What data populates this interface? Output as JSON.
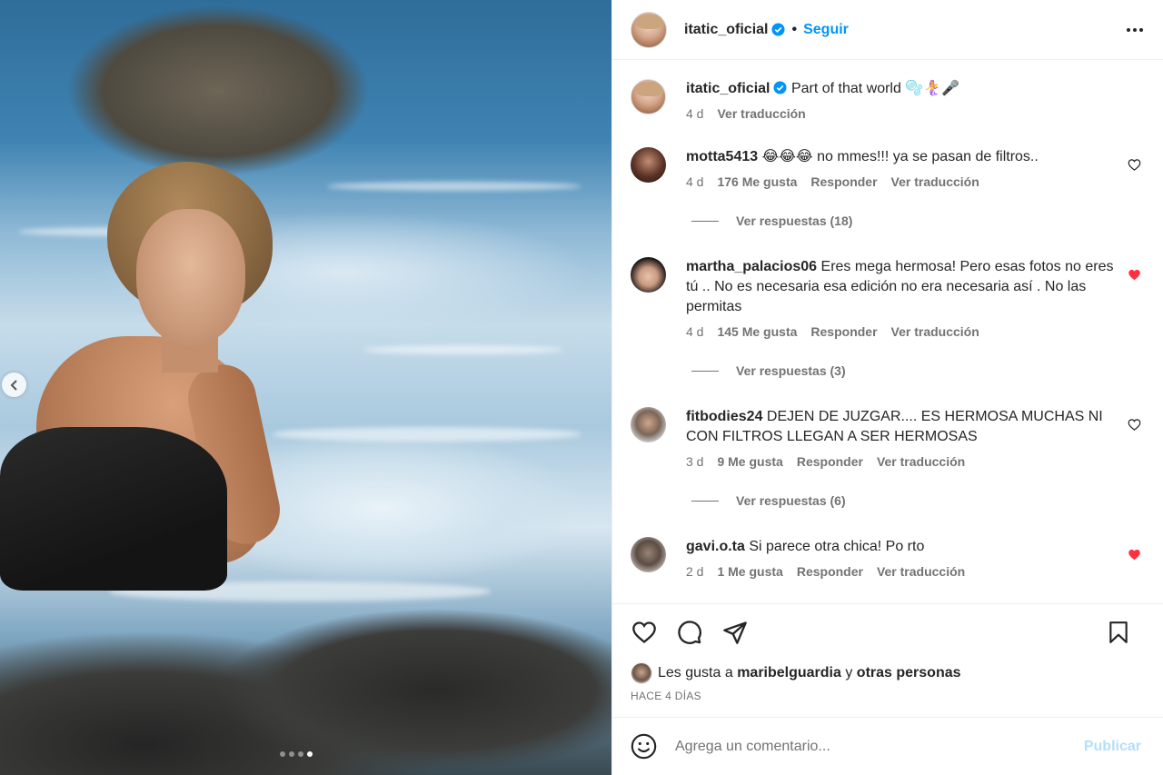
{
  "post": {
    "carousel_dots": 4,
    "active_dot": 3,
    "header": {
      "username": "itatic_oficial",
      "separator": "•",
      "follow_label": "Seguir"
    },
    "caption": {
      "username": "itatic_oficial",
      "text": "Part of that world 🫧🧜‍♀️🎤",
      "time": "4 d",
      "translate_label": "Ver traducción"
    },
    "comments": [
      {
        "username": "motta5413",
        "text": "😂😂😂 no mmes!!! ya se pasan de filtros..",
        "time": "4 d",
        "likes": "176 Me gusta",
        "reply_label": "Responder",
        "translate_label": "Ver traducción",
        "liked": false,
        "replies_label": "Ver respuestas (18)"
      },
      {
        "username": "martha_palacios06",
        "text": "Eres mega hermosa! Pero esas fotos no eres tú .. No es necesaria esa edición no era necesaria así . No las permitas",
        "time": "4 d",
        "likes": "145 Me gusta",
        "reply_label": "Responder",
        "translate_label": "Ver traducción",
        "liked": true,
        "replies_label": "Ver respuestas (3)"
      },
      {
        "username": "fitbodies24",
        "text": "DEJEN DE JUZGAR.... ES HERMOSA MUCHAS NI CON FILTROS LLEGAN A SER HERMOSAS",
        "time": "3 d",
        "likes": "9 Me gusta",
        "reply_label": "Responder",
        "translate_label": "Ver traducción",
        "liked": false,
        "replies_label": "Ver respuestas (6)"
      },
      {
        "username": "gavi.o.ta",
        "text": "Si parece otra chica! Po rto",
        "time": "2 d",
        "likes": "1 Me gusta",
        "reply_label": "Responder",
        "translate_label": "Ver traducción",
        "liked": true
      }
    ],
    "likes_line": {
      "prefix": "Les gusta a",
      "user": "maribelguardia",
      "conjunction": "y",
      "others": "otras personas"
    },
    "posted_ago": "HACE 4 DÍAS",
    "add_comment": {
      "placeholder": "Agrega un comentario...",
      "publish_label": "Publicar"
    }
  },
  "colors": {
    "accent": "#0095f6",
    "like_red": "#ff3040",
    "muted": "#737373",
    "publish_disabled": "#b2dffc"
  }
}
